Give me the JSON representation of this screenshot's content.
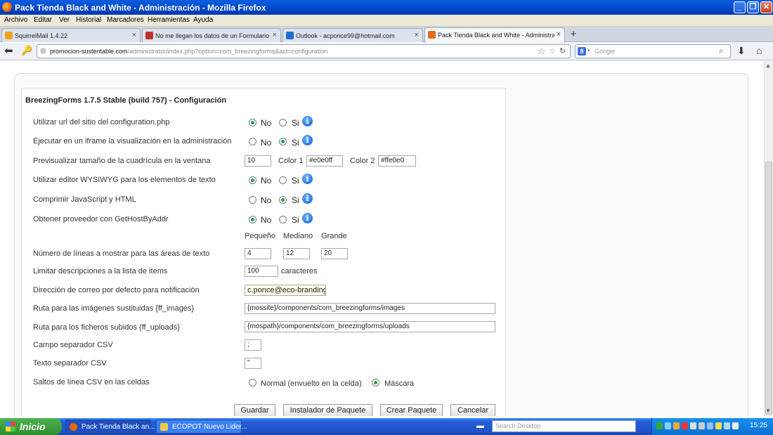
{
  "window": {
    "title": "Pack Tienda Black and White - Administración - Mozilla Firefox"
  },
  "menu": [
    "Archivo",
    "Editar",
    "Ver",
    "Historial",
    "Marcadores",
    "Herramientas",
    "Ayuda"
  ],
  "tabs": [
    {
      "label": "SquirrelMail 1.4.22",
      "icon_color": "#f0a020"
    },
    {
      "label": "No me llegan los datos de un Formulario ...",
      "icon_color": "#c0302e"
    },
    {
      "label": "Outlook - acponce99@hotmail.com",
      "icon_color": "#1f6fd0"
    },
    {
      "label": "Pack Tienda Black and White - Administra...",
      "icon_color": "#e36d1d"
    }
  ],
  "address": {
    "domain": "promocion-sustentable.com",
    "path": "/administrator/index.php?option=com_breezingforms&act=configuration"
  },
  "search": {
    "placeholder": "Google"
  },
  "panel": {
    "title": "BreezingForms 1.7.5 Stable (build 757) - Configuración"
  },
  "settings": {
    "no_label": "No",
    "si_label": "Si",
    "info_glyph": "i",
    "rows": [
      {
        "label": "Utilizar url del sitio del configuration.php",
        "value": "No"
      },
      {
        "label": "Ejecutar en un iframe la visualización en la administración",
        "value": "Si"
      },
      {
        "label": "Previsualizar tamaño de la cuadrícula en la ventana"
      },
      {
        "label": "Utilizar editor WYSIWYG para los elementos de texto",
        "value": "No"
      },
      {
        "label": "Comprimir JavaScript y HTML",
        "value": "Si"
      },
      {
        "label": "Obtener proveedor con GetHostByAddr",
        "value": "No"
      },
      {
        "label": "Número de líneas a mostrar para las áreas de texto"
      },
      {
        "label": "Limitar descripciones a la lista de items"
      },
      {
        "label": "Dirección de correo por defecto para notificación"
      },
      {
        "label": "Ruta para las imágenes sustituidas {ff_images}"
      },
      {
        "label": "Ruta para los ficheros subidos {ff_uploads}"
      },
      {
        "label": "Campo separador CSV"
      },
      {
        "label": "Texto separador CSV"
      },
      {
        "label": "Saltos de línea CSV en las celdas"
      }
    ],
    "grid": {
      "size": "10",
      "color1_label": "Color 1",
      "color1": "#e0e0ff",
      "color2_label": "Color 2",
      "color2": "#ffe0e0"
    },
    "size_headers": [
      "Pequeño",
      "Mediano",
      "Grande"
    ],
    "textarea_lines": [
      "4",
      "12",
      "20"
    ],
    "desc_limit": "100",
    "desc_unit": "caracteres",
    "email": "c.ponce@eco-branding",
    "images_path": "{mossite}/components/com_breezingforms/images",
    "uploads_path": "{mospath}/components/com_breezingforms/uploads",
    "csv_field_sep": ";",
    "csv_text_sep": "\"",
    "linebreak_options": [
      "Normal (envuelto en la celda)",
      "Máscara"
    ],
    "linebreak_value": "Máscara"
  },
  "buttons": {
    "save": "Guardar",
    "installer": "Instalador de Paquete",
    "create": "Crear Paquete",
    "cancel": "Cancelar"
  },
  "taskbar": {
    "start": "Inicio",
    "tasks": [
      "Pack Tienda Black an...",
      "ECOPOT Nuevo Lider..."
    ],
    "search_placeholder": "Search Desktop",
    "clock": "15:25"
  }
}
